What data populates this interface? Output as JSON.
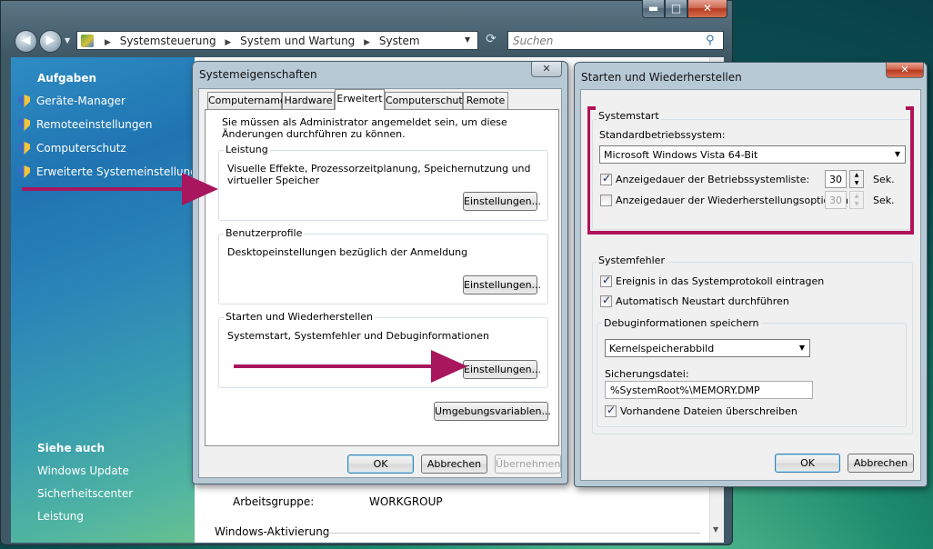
{
  "explorer": {
    "caption_buttons": {
      "minimize": "▬",
      "maximize": "□",
      "close": "✕"
    },
    "address_crumbs": [
      "Systemsteuerung",
      "System und Wartung",
      "System"
    ],
    "search_placeholder": "Suchen",
    "taskpane": {
      "tasks_heading": "Aufgaben",
      "tasks": [
        "Geräte-Manager",
        "Remoteeinstellungen",
        "Computerschutz",
        "Erweiterte Systemeinstellungen"
      ],
      "see_also_heading": "Siehe auch",
      "see_also": [
        "Windows Update",
        "Sicherheitscenter",
        "Leistung"
      ]
    },
    "content": {
      "workgroup_label": "Arbeitsgruppe:",
      "workgroup_value": "WORKGROUP",
      "activation_heading": "Windows-Aktivierung"
    }
  },
  "system_properties": {
    "title": "Systemeigenschaften",
    "tabs": [
      "Computername",
      "Hardware",
      "Erweitert",
      "Computerschutz",
      "Remote"
    ],
    "active_tab": "Erweitert",
    "admin_note": "Sie müssen als Administrator angemeldet sein, um diese Änderungen durchführen zu können.",
    "groups": [
      {
        "title": "Leistung",
        "text": "Visuelle Effekte, Prozessorzeitplanung, Speichernutzung und virtueller Speicher",
        "button": "Einstellungen..."
      },
      {
        "title": "Benutzerprofile",
        "text": "Desktopeinstellungen bezüglich der Anmeldung",
        "button": "Einstellungen..."
      },
      {
        "title": "Starten und Wiederherstellen",
        "text": "Systemstart, Systemfehler und Debuginformationen",
        "button": "Einstellungen..."
      }
    ],
    "env_button": "Umgebungsvariablen...",
    "ok": "OK",
    "cancel": "Abbrechen",
    "apply": "Übernehmen"
  },
  "startup_recovery": {
    "title": "Starten und Wiederherstellen",
    "systemstart_group": "Systemstart",
    "default_os_label": "Standardbetriebssystem:",
    "default_os_value": "Microsoft Windows Vista 64-Bit",
    "os_list_label": "Anzeigedauer der Betriebssystemliste:",
    "os_list_checked": true,
    "os_list_value": "30",
    "recovery_label": "Anzeigedauer der Wiederherstellungsoptionen:",
    "recovery_checked": false,
    "recovery_value": "30",
    "seconds_unit": "Sek.",
    "systemfehler_group": "Systemfehler",
    "write_event_label": "Ereignis in das Systemprotokoll eintragen",
    "write_event_checked": true,
    "auto_restart_label": "Automatisch Neustart durchführen",
    "auto_restart_checked": true,
    "debug_group": "Debuginformationen speichern",
    "debug_type": "Kernelspeicherabbild",
    "dump_file_label": "Sicherungsdatei:",
    "dump_file_value": "%SystemRoot%\\MEMORY.DMP",
    "overwrite_label": "Vorhandene Dateien überschreiben",
    "overwrite_checked": true,
    "ok": "OK",
    "cancel": "Abbrechen"
  },
  "colors": {
    "highlight": "#b1115a"
  }
}
